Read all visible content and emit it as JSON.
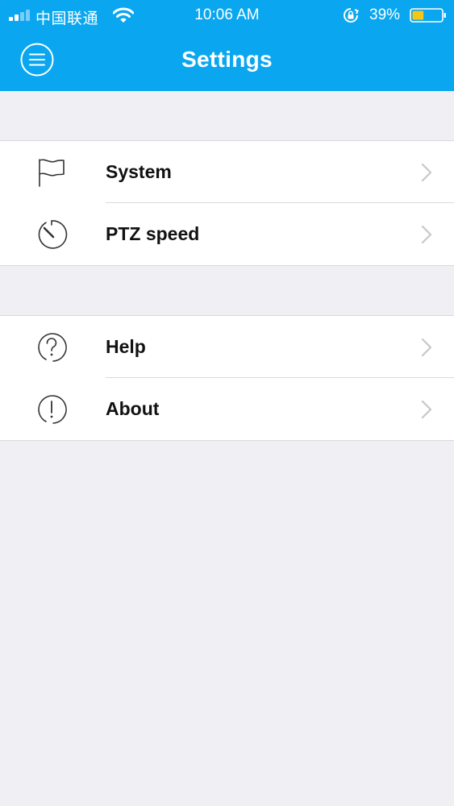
{
  "status_bar": {
    "carrier": "中国联通",
    "time": "10:06 AM",
    "battery_percent": "39%",
    "battery_level": 0.39,
    "battery_color": "#f5c518"
  },
  "header": {
    "title": "Settings",
    "menu_icon": "menu-icon",
    "background_color": "#0aa7f0"
  },
  "groups": [
    {
      "items": [
        {
          "label": "System",
          "icon": "flag-icon"
        },
        {
          "label": "PTZ speed",
          "icon": "speed-gauge-icon"
        }
      ]
    },
    {
      "items": [
        {
          "label": "Help",
          "icon": "help-icon"
        },
        {
          "label": "About",
          "icon": "info-exclamation-icon"
        }
      ]
    }
  ]
}
